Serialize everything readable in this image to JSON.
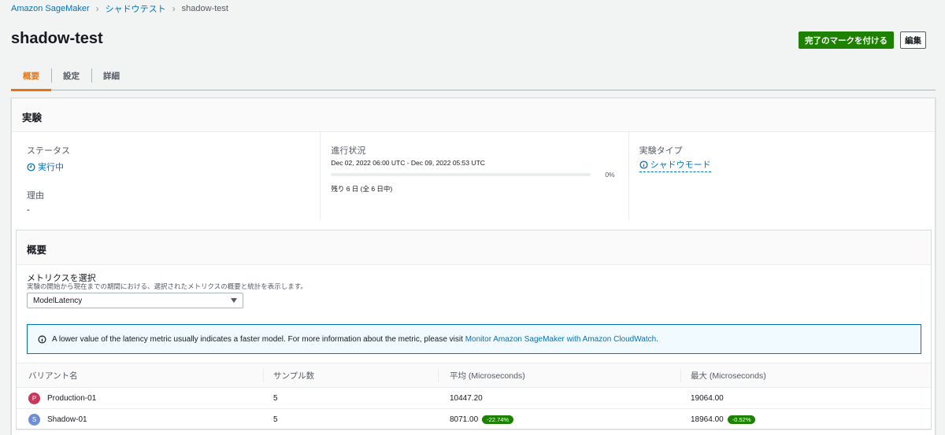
{
  "breadcrumb": {
    "items": [
      "Amazon SageMaker",
      "シャドウテスト"
    ],
    "current": "shadow-test"
  },
  "page": {
    "title": "shadow-test"
  },
  "actions": {
    "mark_complete": "完了のマークを付ける",
    "edit": "編集"
  },
  "tabs": [
    "概要",
    "設定",
    "詳細"
  ],
  "experiment": {
    "title": "実験",
    "status_label": "ステータス",
    "status_value": "実行中",
    "reason_label": "理由",
    "reason_value": "-",
    "progress_label": "進行状況",
    "progress_range": "Dec 02, 2022 06:00 UTC - Dec 09, 2022 05:53 UTC",
    "progress_percent": "0%",
    "progress_fraction": 0.0,
    "remaining": "残り 6 日 (全 6 日中)",
    "type_label": "実験タイプ",
    "type_value": "シャドウモード"
  },
  "overview": {
    "title": "概要",
    "metric_label": "メトリクスを選択",
    "metric_description": "実験の開始から現在までの期間における、選択されたメトリクスの概要と統計を表示します。",
    "metric_selected": "ModelLatency",
    "alert_text": "A lower value of the latency metric usually indicates a faster model. For more information about the metric, please visit ",
    "alert_link": "Monitor Amazon SageMaker with Amazon CloudWatch",
    "alert_end": "."
  },
  "table": {
    "headers": [
      "バリアント名",
      "サンプル数",
      "平均 (Microseconds)",
      "最大 (Microseconds)"
    ],
    "rows": [
      {
        "avatar": "P",
        "avatar_color": "#c7385c",
        "name": "Production-01",
        "samples": "5",
        "avg": "10447.20",
        "avg_badge": "",
        "max": "19064.00",
        "max_badge": ""
      },
      {
        "avatar": "S",
        "avatar_color": "#6f8fd1",
        "name": "Shadow-01",
        "samples": "5",
        "avg": "8071.00",
        "avg_badge": "-22.74%",
        "max": "18964.00",
        "max_badge": "-0.52%"
      }
    ]
  },
  "colors": {
    "accent": "#ec7211",
    "link": "#0073bb",
    "success": "#1d8102"
  }
}
